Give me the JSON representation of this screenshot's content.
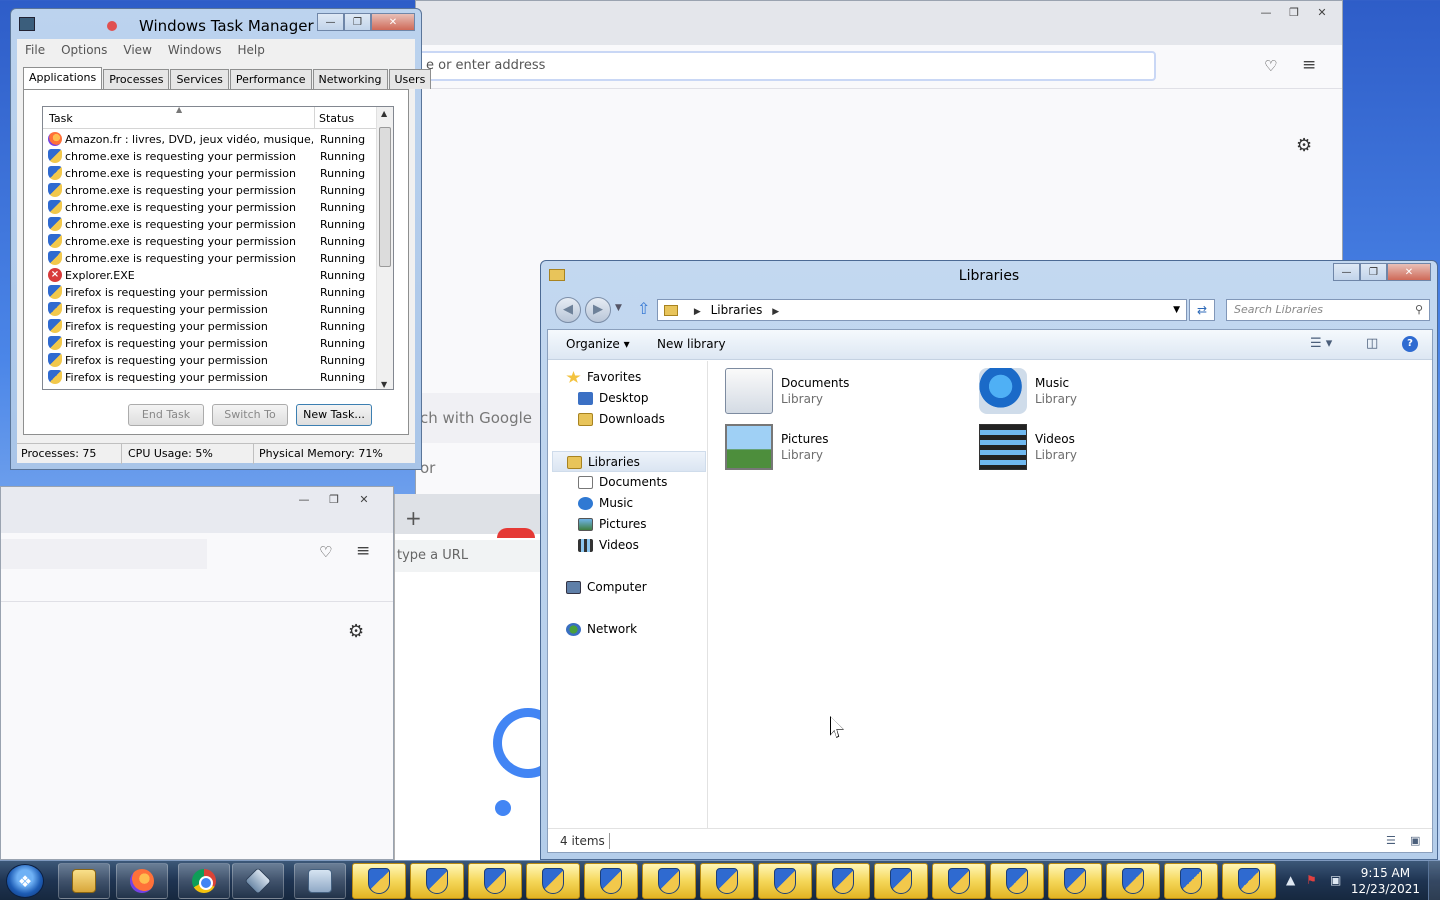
{
  "firefox_main": {
    "urlbar_placeholder": "e or enter address",
    "search_fragment": "ch with Google or"
  },
  "chrome": {
    "omnibox_fragment": "type a URL",
    "new_tab_symbol": "+"
  },
  "task_manager": {
    "title": "Windows Task Manager",
    "menu": [
      "File",
      "Options",
      "View",
      "Windows",
      "Help"
    ],
    "tabs": [
      "Applications",
      "Processes",
      "Services",
      "Performance",
      "Networking",
      "Users"
    ],
    "active_tab": "Applications",
    "columns": {
      "task": "Task",
      "status": "Status"
    },
    "rows": [
      {
        "icon": "amazon-firefox",
        "task": "Amazon.fr : livres, DVD, jeux vidéo, musique, hi...",
        "status": "Running"
      },
      {
        "icon": "shield",
        "task": "chrome.exe is requesting your permission",
        "status": "Running"
      },
      {
        "icon": "shield",
        "task": "chrome.exe is requesting your permission",
        "status": "Running"
      },
      {
        "icon": "shield",
        "task": "chrome.exe is requesting your permission",
        "status": "Running"
      },
      {
        "icon": "shield",
        "task": "chrome.exe is requesting your permission",
        "status": "Running"
      },
      {
        "icon": "shield",
        "task": "chrome.exe is requesting your permission",
        "status": "Running"
      },
      {
        "icon": "shield",
        "task": "chrome.exe is requesting your permission",
        "status": "Running"
      },
      {
        "icon": "shield",
        "task": "chrome.exe is requesting your permission",
        "status": "Running"
      },
      {
        "icon": "error",
        "task": "Explorer.EXE",
        "status": "Running"
      },
      {
        "icon": "shield",
        "task": "Firefox is requesting your permission",
        "status": "Running"
      },
      {
        "icon": "shield",
        "task": "Firefox is requesting your permission",
        "status": "Running"
      },
      {
        "icon": "shield",
        "task": "Firefox is requesting your permission",
        "status": "Running"
      },
      {
        "icon": "shield",
        "task": "Firefox is requesting your permission",
        "status": "Running"
      },
      {
        "icon": "shield",
        "task": "Firefox is requesting your permission",
        "status": "Running"
      },
      {
        "icon": "shield",
        "task": "Firefox is requesting your permission",
        "status": "Running"
      }
    ],
    "buttons": {
      "end_task": "End Task",
      "switch_to": "Switch To",
      "new_task": "New Task..."
    },
    "status": {
      "processes": "Processes: 75",
      "cpu": "CPU Usage: 5%",
      "memory": "Physical Memory: 71%"
    }
  },
  "explorer": {
    "title": "Libraries",
    "address": "Libraries",
    "search_placeholder": "Search Libraries",
    "commands": {
      "organize": "Organize",
      "new_library": "New library"
    },
    "nav": {
      "favorites": "Favorites",
      "desktop": "Desktop",
      "downloads": "Downloads",
      "libraries": "Libraries",
      "documents": "Documents",
      "music": "Music",
      "pictures": "Pictures",
      "videos": "Videos",
      "computer": "Computer",
      "network": "Network"
    },
    "items": [
      {
        "name": "Documents",
        "type": "Library"
      },
      {
        "name": "Music",
        "type": "Library"
      },
      {
        "name": "Pictures",
        "type": "Library"
      },
      {
        "name": "Videos",
        "type": "Library"
      }
    ],
    "status": "4 items"
  },
  "taskbar": {
    "clock_time": "9:15 AM",
    "clock_date": "12/23/2021",
    "uac_button_count": 16
  }
}
